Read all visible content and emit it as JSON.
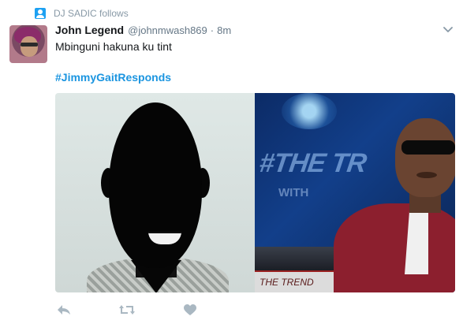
{
  "context": {
    "icon": "follow-person-icon",
    "text": "DJ SADIC follows"
  },
  "tweet": {
    "author_name": "John Legend",
    "handle": "@johnmwash869",
    "separator": "·",
    "time": "8m",
    "text": "Mbinguni hakuna ku tint",
    "hashtag": "#JimmyGaitResponds",
    "media": {
      "left_panel": "silhouette with white teeth",
      "right_caption": "THE TREND",
      "right_screen_text": "#THE TR",
      "right_screen_sub": "WITH"
    }
  },
  "actions": [
    {
      "icon": "reply-icon"
    },
    {
      "icon": "retweet-icon"
    },
    {
      "icon": "like-heart-icon"
    }
  ],
  "colors": {
    "link": "#1b95e0",
    "muted": "#657786",
    "text": "#14171a",
    "icon_gray": "#aab8c2"
  }
}
